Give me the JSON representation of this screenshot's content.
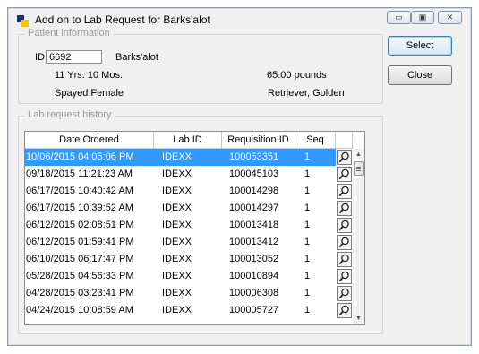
{
  "window": {
    "title": "Add on to Lab Request for Barks'alot",
    "min_glyph": "▭",
    "max_glyph": "▣",
    "close_glyph": "✕"
  },
  "patient": {
    "group_label": "Patient information",
    "id_label": "ID:",
    "id_value": "6692",
    "name": "Barks'alot",
    "age": "11 Yrs. 10 Mos.",
    "weight": "65.00 pounds",
    "sex": "Spayed Female",
    "breed": "Retriever, Golden"
  },
  "actions": {
    "select_label": "Select",
    "close_label": "Close"
  },
  "history": {
    "group_label": "Lab request history",
    "columns": [
      "Date Ordered",
      "Lab ID",
      "Requisition ID",
      "Seq"
    ],
    "rows": [
      {
        "date": "10/06/2015 04:05:06 PM",
        "lab": "IDEXX",
        "req": "100053351",
        "seq": "1",
        "selected": true
      },
      {
        "date": "09/18/2015 11:21:23 AM",
        "lab": "IDEXX",
        "req": "100045103",
        "seq": "1"
      },
      {
        "date": "06/17/2015 10:40:42 AM",
        "lab": "IDEXX",
        "req": "100014298",
        "seq": "1"
      },
      {
        "date": "06/17/2015 10:39:52 AM",
        "lab": "IDEXX",
        "req": "100014297",
        "seq": "1"
      },
      {
        "date": "06/12/2015 02:08:51 PM",
        "lab": "IDEXX",
        "req": "100013418",
        "seq": "1"
      },
      {
        "date": "06/12/2015 01:59:41 PM",
        "lab": "IDEXX",
        "req": "100013412",
        "seq": "1"
      },
      {
        "date": "06/10/2015 06:17:47 PM",
        "lab": "IDEXX",
        "req": "100013052",
        "seq": "1"
      },
      {
        "date": "05/28/2015 04:56:33 PM",
        "lab": "IDEXX",
        "req": "100010894",
        "seq": "1"
      },
      {
        "date": "04/28/2015 03:23:41 PM",
        "lab": "IDEXX",
        "req": "100006308",
        "seq": "1"
      },
      {
        "date": "04/24/2015 10:08:59 AM",
        "lab": "IDEXX",
        "req": "100005727",
        "seq": "1"
      }
    ],
    "row_button_icon": "magnifier-icon",
    "selected_color": "#3399ff"
  }
}
